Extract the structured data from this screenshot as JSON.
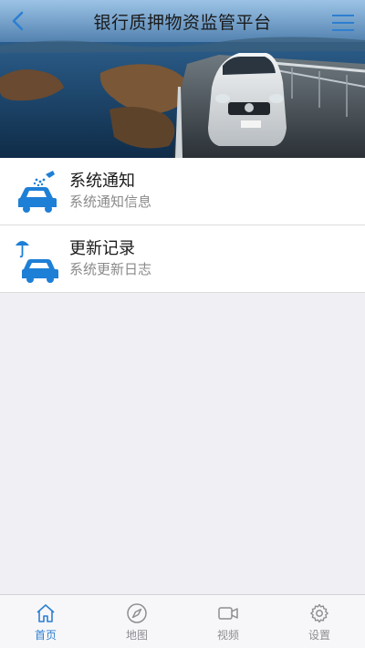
{
  "header": {
    "title": "银行质押物资监管平台"
  },
  "list": [
    {
      "title": "系统通知",
      "subtitle": "系统通知信息",
      "icon": "car-wash-icon"
    },
    {
      "title": "更新记录",
      "subtitle": "系统更新日志",
      "icon": "car-umbrella-icon"
    }
  ],
  "tabs": [
    {
      "label": "首页",
      "icon": "home-icon",
      "active": true
    },
    {
      "label": "地图",
      "icon": "navigation-icon",
      "active": false
    },
    {
      "label": "视频",
      "icon": "video-camera-icon",
      "active": false
    },
    {
      "label": "设置",
      "icon": "gear-icon",
      "active": false
    }
  ],
  "colors": {
    "accent": "#2d7fd1",
    "inactive": "#8e8e93",
    "background": "#efeff4"
  }
}
